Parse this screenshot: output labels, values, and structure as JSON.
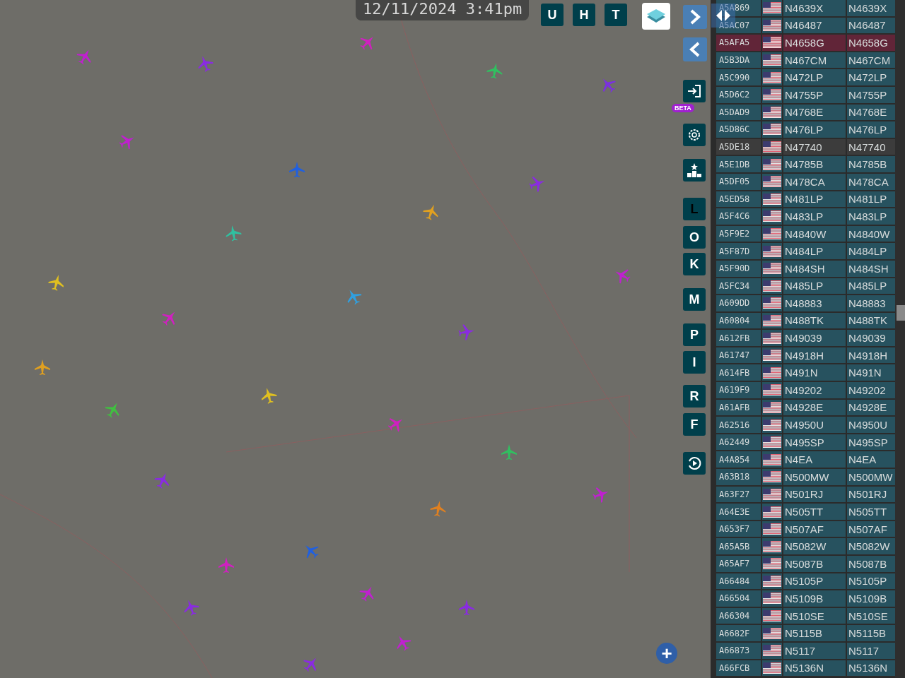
{
  "clock": "12/11/2024 3:41pm",
  "top_buttons": [
    {
      "label": "U"
    },
    {
      "label": "H"
    },
    {
      "label": "T"
    }
  ],
  "beta_badge": "BETA",
  "side_buttons": [
    {
      "label": "L",
      "active": true
    },
    {
      "label": "O",
      "active": false
    },
    {
      "label": "K",
      "active": false
    },
    {
      "label": "M",
      "active": false
    },
    {
      "label": "P",
      "active": false
    },
    {
      "label": "I",
      "active": false
    },
    {
      "label": "R",
      "active": false
    },
    {
      "label": "F",
      "active": false
    }
  ],
  "zoom_in": "+",
  "aircraft_table": {
    "rows": [
      {
        "hex": "A5A869",
        "registration": "N4639X",
        "callsign": "N4639X",
        "selected": false,
        "stale": false
      },
      {
        "hex": "A5AC07",
        "registration": "N46487",
        "callsign": "N46487",
        "selected": false,
        "stale": false
      },
      {
        "hex": "A5AFA5",
        "registration": "N4658G",
        "callsign": "N4658G",
        "selected": true,
        "stale": false
      },
      {
        "hex": "A5B3DA",
        "registration": "N467CM",
        "callsign": "N467CM",
        "selected": false,
        "stale": false
      },
      {
        "hex": "A5C990",
        "registration": "N472LP",
        "callsign": "N472LP",
        "selected": false,
        "stale": false
      },
      {
        "hex": "A5D6C2",
        "registration": "N4755P",
        "callsign": "N4755P",
        "selected": false,
        "stale": false
      },
      {
        "hex": "A5DAD9",
        "registration": "N4768E",
        "callsign": "N4768E",
        "selected": false,
        "stale": false
      },
      {
        "hex": "A5D86C",
        "registration": "N476LP",
        "callsign": "N476LP",
        "selected": false,
        "stale": false
      },
      {
        "hex": "A5DE18",
        "registration": "N47740",
        "callsign": "N47740",
        "selected": false,
        "stale": true
      },
      {
        "hex": "A5E1DB",
        "registration": "N4785B",
        "callsign": "N4785B",
        "selected": false,
        "stale": false
      },
      {
        "hex": "A5DF05",
        "registration": "N478CA",
        "callsign": "N478CA",
        "selected": false,
        "stale": false
      },
      {
        "hex": "A5ED58",
        "registration": "N481LP",
        "callsign": "N481LP",
        "selected": false,
        "stale": false
      },
      {
        "hex": "A5F4C6",
        "registration": "N483LP",
        "callsign": "N483LP",
        "selected": false,
        "stale": false
      },
      {
        "hex": "A5F9E2",
        "registration": "N4840W",
        "callsign": "N4840W",
        "selected": false,
        "stale": false
      },
      {
        "hex": "A5F87D",
        "registration": "N484LP",
        "callsign": "N484LP",
        "selected": false,
        "stale": false
      },
      {
        "hex": "A5F90D",
        "registration": "N484SH",
        "callsign": "N484SH",
        "selected": false,
        "stale": false
      },
      {
        "hex": "A5FC34",
        "registration": "N485LP",
        "callsign": "N485LP",
        "selected": false,
        "stale": false
      },
      {
        "hex": "A609DD",
        "registration": "N48883",
        "callsign": "N48883",
        "selected": false,
        "stale": false
      },
      {
        "hex": "A60804",
        "registration": "N488TK",
        "callsign": "N488TK",
        "selected": false,
        "stale": false
      },
      {
        "hex": "A612FB",
        "registration": "N49039",
        "callsign": "N49039",
        "selected": false,
        "stale": false
      },
      {
        "hex": "A61747",
        "registration": "N4918H",
        "callsign": "N4918H",
        "selected": false,
        "stale": false
      },
      {
        "hex": "A614FB",
        "registration": "N491N",
        "callsign": "N491N",
        "selected": false,
        "stale": false
      },
      {
        "hex": "A619F9",
        "registration": "N49202",
        "callsign": "N49202",
        "selected": false,
        "stale": false
      },
      {
        "hex": "A61AFB",
        "registration": "N4928E",
        "callsign": "N4928E",
        "selected": false,
        "stale": false
      },
      {
        "hex": "A62516",
        "registration": "N4950U",
        "callsign": "N4950U",
        "selected": false,
        "stale": false
      },
      {
        "hex": "A62449",
        "registration": "N495SP",
        "callsign": "N495SP",
        "selected": false,
        "stale": false
      },
      {
        "hex": "A4A854",
        "registration": "N4EA",
        "callsign": "N4EA",
        "selected": false,
        "stale": false
      },
      {
        "hex": "A63B18",
        "registration": "N500MW",
        "callsign": "N500MW",
        "selected": false,
        "stale": false
      },
      {
        "hex": "A63F27",
        "registration": "N501RJ",
        "callsign": "N501RJ",
        "selected": false,
        "stale": false
      },
      {
        "hex": "A64E3E",
        "registration": "N505TT",
        "callsign": "N505TT",
        "selected": false,
        "stale": false
      },
      {
        "hex": "A653F7",
        "registration": "N507AF",
        "callsign": "N507AF",
        "selected": false,
        "stale": false
      },
      {
        "hex": "A65A5B",
        "registration": "N5082W",
        "callsign": "N5082W",
        "selected": false,
        "stale": false
      },
      {
        "hex": "A65AF7",
        "registration": "N5087B",
        "callsign": "N5087B",
        "selected": false,
        "stale": false
      },
      {
        "hex": "A66484",
        "registration": "N5105P",
        "callsign": "N5105P",
        "selected": false,
        "stale": false
      },
      {
        "hex": "A66504",
        "registration": "N5109B",
        "callsign": "N5109B",
        "selected": false,
        "stale": false
      },
      {
        "hex": "A66304",
        "registration": "N510SE",
        "callsign": "N510SE",
        "selected": false,
        "stale": false
      },
      {
        "hex": "A6682F",
        "registration": "N5115B",
        "callsign": "N5115B",
        "selected": false,
        "stale": false
      },
      {
        "hex": "A66873",
        "registration": "N5117",
        "callsign": "N5117",
        "selected": false,
        "stale": false
      },
      {
        "hex": "A66FCB",
        "registration": "N5136N",
        "callsign": "N5136N",
        "selected": false,
        "stale": false
      }
    ]
  }
}
